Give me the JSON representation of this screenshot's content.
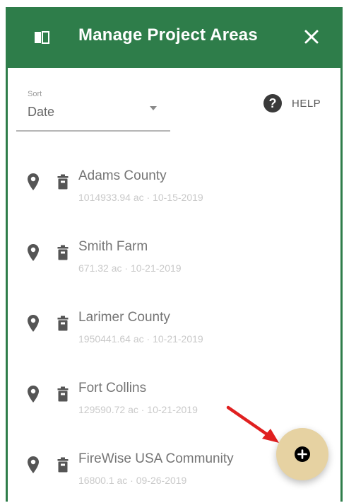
{
  "header": {
    "title": "Manage Project Areas"
  },
  "sort": {
    "label": "Sort",
    "value": "Date"
  },
  "help": {
    "label": "HELP",
    "glyph": "?"
  },
  "project_areas": [
    {
      "name": "Adams County",
      "meta": "1014933.94 ac · 10-15-2019"
    },
    {
      "name": "Smith Farm",
      "meta": "671.32 ac · 10-21-2019"
    },
    {
      "name": "Larimer County",
      "meta": "1950441.64 ac · 10-21-2019"
    },
    {
      "name": "Fort Collins",
      "meta": "129590.72 ac · 10-21-2019"
    },
    {
      "name": "FireWise USA Community",
      "meta": "16800.1 ac · 09-26-2019"
    }
  ],
  "icons": {
    "panel": "panel-toggle-icon",
    "close": "close-icon",
    "dropdown": "chevron-down-icon",
    "help": "help-icon",
    "locate": "map-pin-icon",
    "delete": "trash-icon",
    "add": "plus-circle-icon",
    "annotation": "red-arrow-icon"
  },
  "colors": {
    "header_bg": "#2e7d4a",
    "fab_bg": "#e6d2a2",
    "annotation_arrow": "#e02020"
  }
}
